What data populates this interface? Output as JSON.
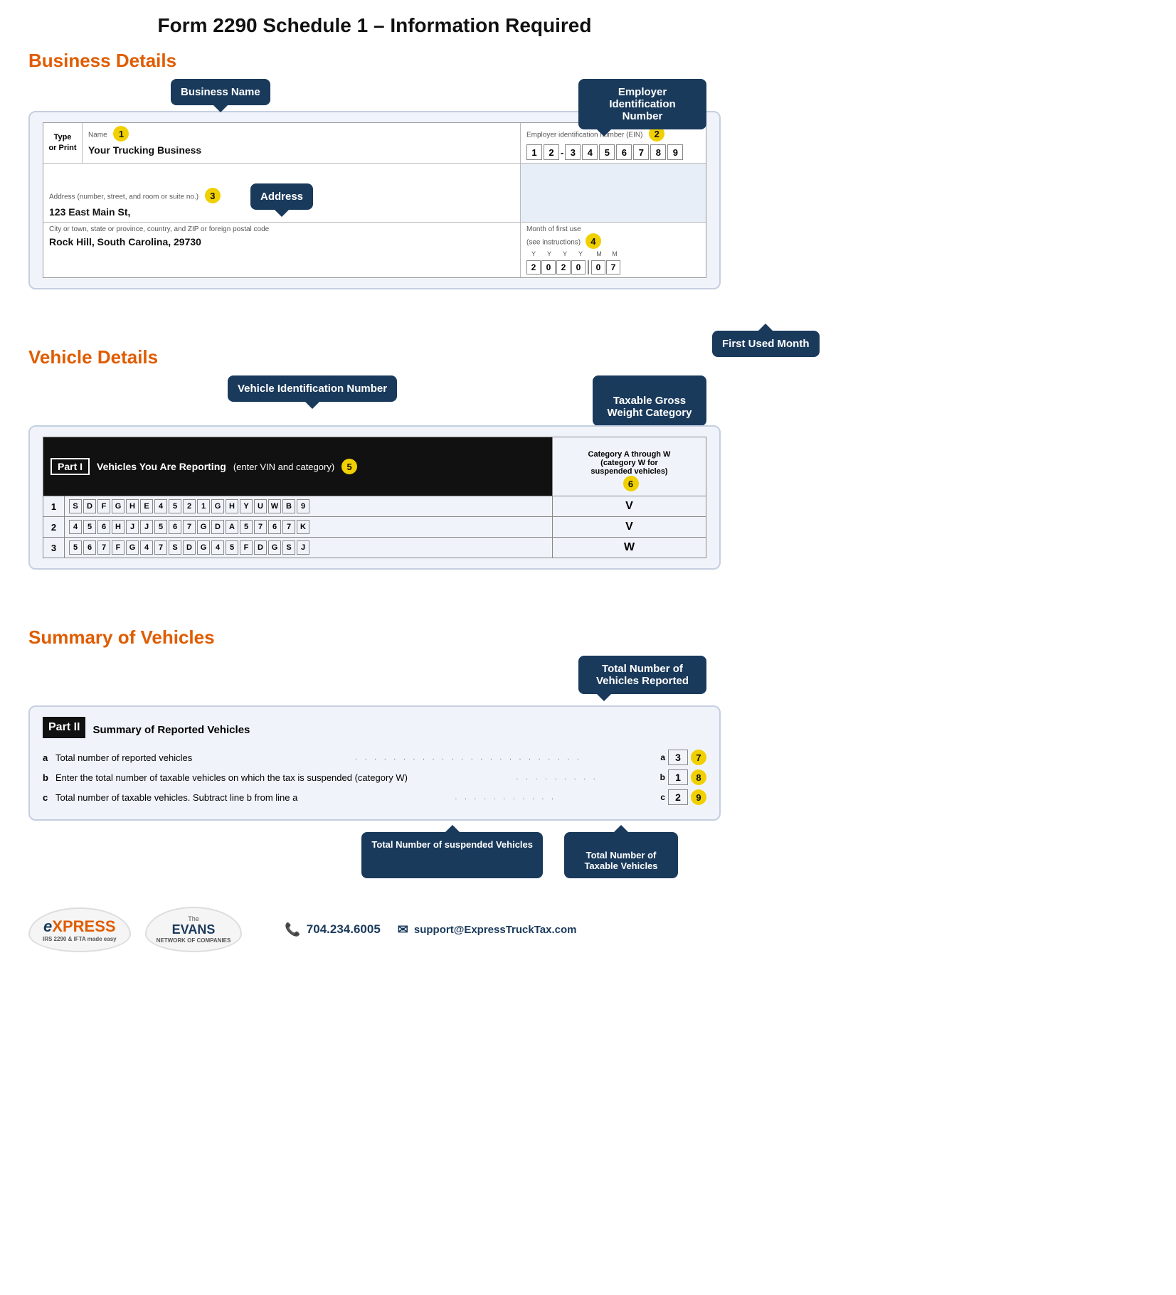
{
  "page": {
    "title": "Form 2290 Schedule 1 – Information Required"
  },
  "sections": {
    "business": {
      "title": "Business Details",
      "callouts": {
        "business_name": "Business Name",
        "employer_id": "Employer Identification Number",
        "address": "Address",
        "first_used_month": "First Used Month"
      },
      "form": {
        "name_label": "Name",
        "name_badge": "1",
        "name_value": "Your Trucking Business",
        "ein_label": "Employer identification number (EIN)",
        "ein_badge": "2",
        "ein_digits": [
          "1",
          "2",
          "-",
          "3",
          "4",
          "5",
          "6",
          "7",
          "8",
          "9"
        ],
        "type_or_print": "Type\nor Print",
        "address_label": "Address (number, street, and room or suite no.)",
        "address_badge": "3",
        "address_value": "123 East Main St,",
        "city_label": "City or town, state or province, country, and ZIP or foreign postal code",
        "city_value": "Rock Hill, South Carolina, 29730",
        "month_label": "Month of first use",
        "month_sublabel": "(see instructions)",
        "month_badge": "4",
        "month_year_label_top": [
          "Y",
          "Y",
          "Y",
          "Y",
          "M",
          "M"
        ],
        "month_values": [
          "2",
          "0",
          "2",
          "0",
          "0",
          "7"
        ]
      }
    },
    "vehicle": {
      "title": "Vehicle Details",
      "callouts": {
        "vin": "Vehicle Identification Number",
        "taxable_gross": "Taxable Gross\nWeight Category"
      },
      "table": {
        "part_label": "Part I",
        "part_title": "Vehicles You Are Reporting",
        "part_subtitle": "(enter VIN and category)",
        "part_badge": "5",
        "category_header": "Category A through W\n(category W for\nsuspended vehicles)",
        "category_badge": "6",
        "rows": [
          {
            "num": "1",
            "vin": [
              "S",
              "D",
              "F",
              "G",
              "H",
              "E",
              "4",
              "5",
              "2",
              "1",
              "G",
              "H",
              "Y",
              "U",
              "W",
              "B",
              "9"
            ],
            "category": "V"
          },
          {
            "num": "2",
            "vin": [
              "4",
              "5",
              "6",
              "H",
              "J",
              "J",
              "5",
              "6",
              "7",
              "G",
              "D",
              "A",
              "5",
              "7",
              "6",
              "7",
              "K"
            ],
            "category": "V"
          },
          {
            "num": "3",
            "vin": [
              "5",
              "6",
              "7",
              "F",
              "G",
              "4",
              "7",
              "S",
              "D",
              "G",
              "4",
              "5",
              "F",
              "D",
              "G",
              "S",
              "J"
            ],
            "category": "W"
          }
        ]
      }
    },
    "summary": {
      "title": "Summary of Vehicles",
      "callouts": {
        "total_reported": "Total Number of Vehicles Reported",
        "total_suspended": "Total Number of suspended Vehicles",
        "total_taxable": "Total Number of\nTaxable Vehicles"
      },
      "table": {
        "part_label": "Part II",
        "part_title": "Summary of Reported Vehicles",
        "row_a_label": "a",
        "row_a_text": "Total number of reported vehicles",
        "row_a_field": "a",
        "row_a_badge": "7",
        "row_a_value": "3",
        "row_b_label": "b",
        "row_b_text": "Enter the total number of taxable vehicles on which the tax is suspended (category W)",
        "row_b_field": "b",
        "row_b_badge": "8",
        "row_b_value": "1",
        "row_c_label": "c",
        "row_c_text": "Total number of taxable vehicles. Subtract line b from line a",
        "row_c_field": "c",
        "row_c_badge": "9",
        "row_c_value": "2"
      }
    }
  },
  "footer": {
    "logo_express_text": "EXPRESS",
    "logo_express_e": "e",
    "logo_express_sub": "IRS 2290 & IFTA made easy",
    "logo_the": "The",
    "logo_evans": "EVANS",
    "logo_network": "NETWORK OF COMPANIES",
    "phone": "704.234.6005",
    "email": "support@ExpressTruckTax.com",
    "phone_icon": "📞",
    "email_icon": "✉"
  }
}
